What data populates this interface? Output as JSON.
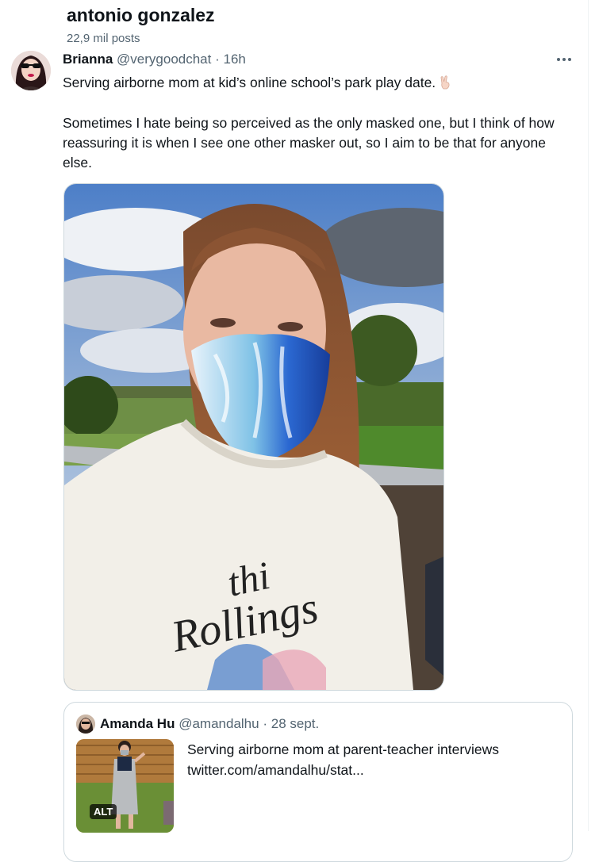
{
  "header": {
    "title": "antonio gonzalez",
    "post_count": "22,9 mil posts"
  },
  "tweet": {
    "author_name": "Brianna",
    "author_handle": "@verygoodchat",
    "separator": "·",
    "time": "16h",
    "paragraph_1": "Serving airborne mom at kid’s online school’s park play date.",
    "paragraph_1_emoji": "victory-hand-emoji",
    "paragraph_2": "Sometimes I hate being so perceived as the only masked one, but I think of how reassuring it is when I see one other masker out, so I aim to be that for anyone else.",
    "more_icon": "more-horizontal-icon"
  },
  "quoted_tweet": {
    "author_name": "Amanda Hu",
    "author_handle": "@amandalhu",
    "separator": "·",
    "date": "28 sept.",
    "text_line_1": "Serving airborne mom at parent-teacher interviews",
    "text_line_2": "twitter.com/amandalhu/stat...",
    "alt_badge": "ALT"
  },
  "colors": {
    "text_primary": "#0f1419",
    "text_secondary": "#536471",
    "border": "#cfd9de",
    "mask_blue": "#1f56c4"
  }
}
